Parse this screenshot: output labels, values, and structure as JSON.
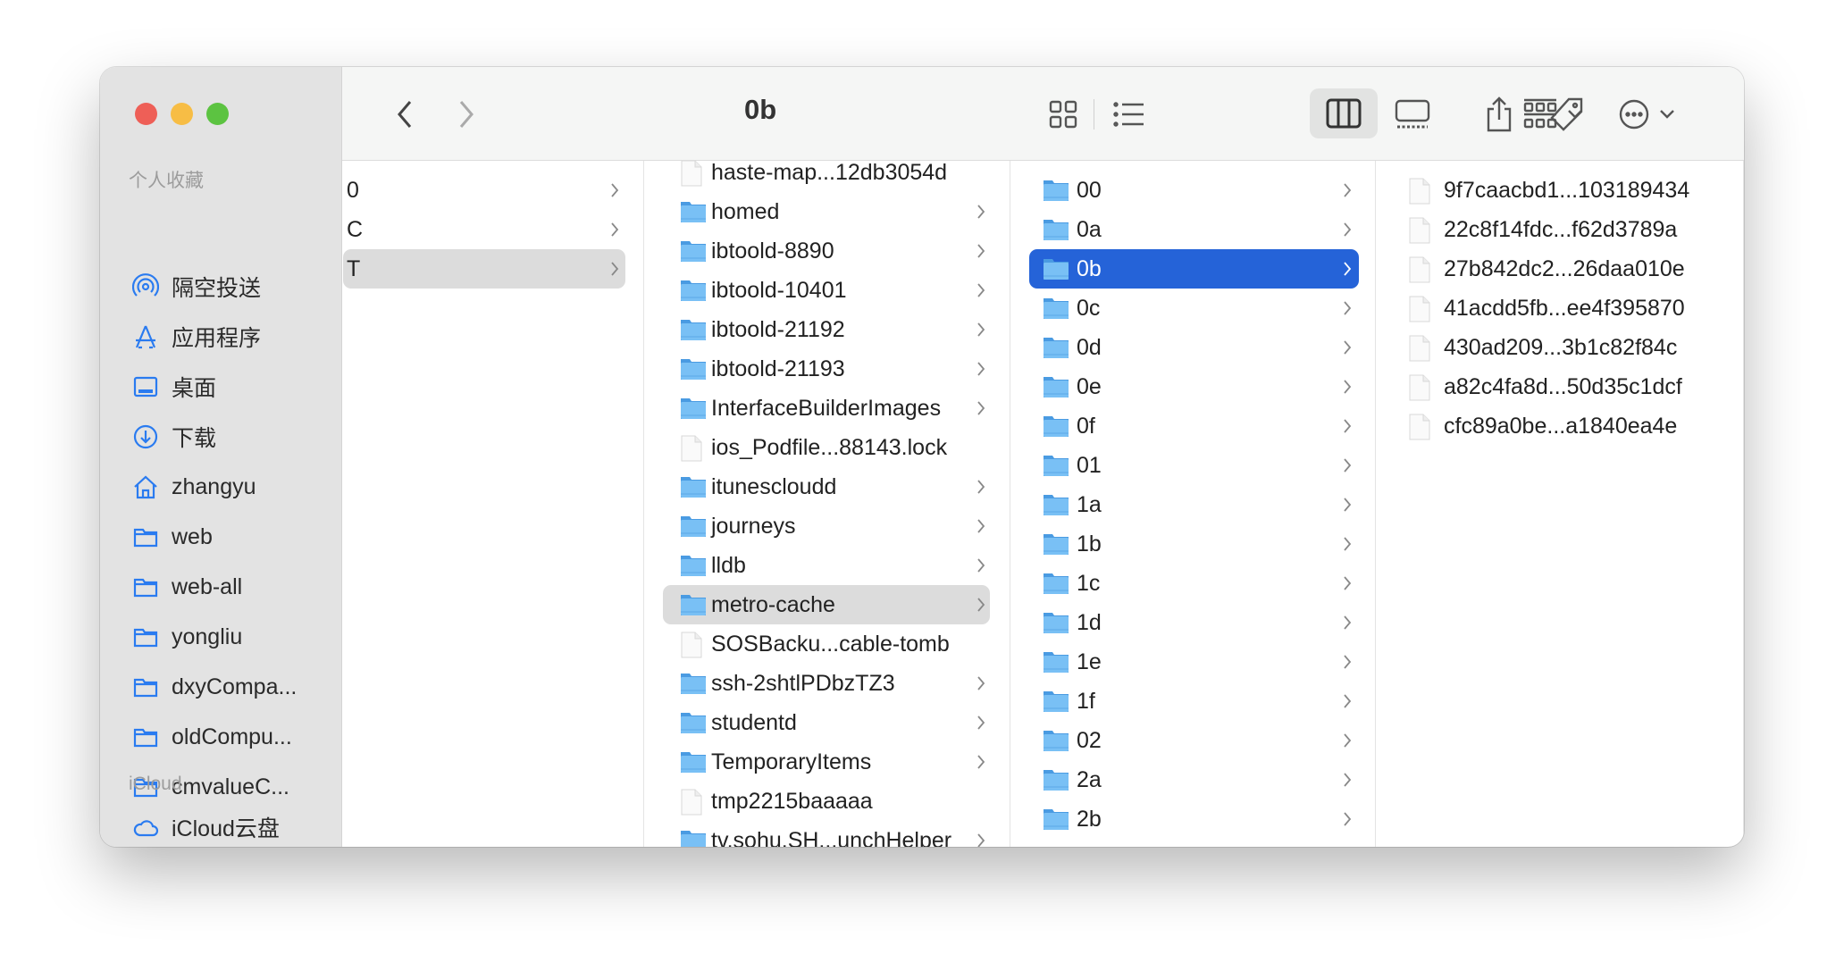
{
  "window": {
    "title": "0b"
  },
  "colors": {
    "accent": "#2563d8",
    "folder": "#6fb8f0",
    "sidebar_icon": "#2a7bf0",
    "close": "#ee5f57",
    "minimize": "#f7bd45",
    "zoom": "#5cc341"
  },
  "sidebar": {
    "favorites_header": "个人收藏",
    "favorites": [
      {
        "label": "隔空投送",
        "icon": "airdrop-icon"
      },
      {
        "label": "应用程序",
        "icon": "applications-icon"
      },
      {
        "label": "桌面",
        "icon": "desktop-icon"
      },
      {
        "label": "下载",
        "icon": "downloads-icon"
      },
      {
        "label": "zhangyu",
        "icon": "home-icon"
      },
      {
        "label": "web",
        "icon": "folder-icon"
      },
      {
        "label": "web-all",
        "icon": "folder-icon"
      },
      {
        "label": "yongliu",
        "icon": "folder-icon"
      },
      {
        "label": "dxyCompa...",
        "icon": "folder-icon"
      },
      {
        "label": "oldCompu...",
        "icon": "folder-icon"
      },
      {
        "label": "cmvalueC...",
        "icon": "folder-icon"
      }
    ],
    "icloud_header": "iCloud",
    "icloud": [
      {
        "label": "iCloud云盘",
        "icon": "cloud-icon"
      }
    ]
  },
  "toolbar": {
    "buttons": [
      "back-icon",
      "forward-icon",
      "icon-view-icon",
      "list-view-icon",
      "column-view-icon",
      "gallery-view-icon",
      "group-icon",
      "share-icon",
      "tag-icon",
      "more-icon",
      "search-icon"
    ],
    "active_view": "column-view"
  },
  "columns": [
    {
      "selected": "T",
      "items": [
        {
          "name": "0",
          "type": "folder-plain"
        },
        {
          "name": "C",
          "type": "folder-plain"
        },
        {
          "name": "T",
          "type": "folder-plain"
        }
      ]
    },
    {
      "selected": "metro-cache",
      "items": [
        {
          "name": "haste-map...12db3054d",
          "type": "file"
        },
        {
          "name": "homed",
          "type": "folder"
        },
        {
          "name": "ibtoold-8890",
          "type": "folder"
        },
        {
          "name": "ibtoold-10401",
          "type": "folder"
        },
        {
          "name": "ibtoold-21192",
          "type": "folder"
        },
        {
          "name": "ibtoold-21193",
          "type": "folder"
        },
        {
          "name": "InterfaceBuilderImages",
          "type": "folder"
        },
        {
          "name": "ios_Podfile...88143.lock",
          "type": "file"
        },
        {
          "name": "itunescloudd",
          "type": "folder"
        },
        {
          "name": "journeys",
          "type": "folder"
        },
        {
          "name": "lldb",
          "type": "folder"
        },
        {
          "name": "metro-cache",
          "type": "folder"
        },
        {
          "name": "SOSBacku...cable-tomb",
          "type": "file"
        },
        {
          "name": "ssh-2shtlPDbzTZ3",
          "type": "folder"
        },
        {
          "name": "studentd",
          "type": "folder"
        },
        {
          "name": "TemporaryItems",
          "type": "folder"
        },
        {
          "name": "tmp2215baaaaa",
          "type": "file"
        },
        {
          "name": "tv.sohu.SH...unchHelper",
          "type": "folder"
        }
      ]
    },
    {
      "selected": "0b",
      "items": [
        {
          "name": "00",
          "type": "folder"
        },
        {
          "name": "0a",
          "type": "folder"
        },
        {
          "name": "0b",
          "type": "folder"
        },
        {
          "name": "0c",
          "type": "folder"
        },
        {
          "name": "0d",
          "type": "folder"
        },
        {
          "name": "0e",
          "type": "folder"
        },
        {
          "name": "0f",
          "type": "folder"
        },
        {
          "name": "01",
          "type": "folder"
        },
        {
          "name": "1a",
          "type": "folder"
        },
        {
          "name": "1b",
          "type": "folder"
        },
        {
          "name": "1c",
          "type": "folder"
        },
        {
          "name": "1d",
          "type": "folder"
        },
        {
          "name": "1e",
          "type": "folder"
        },
        {
          "name": "1f",
          "type": "folder"
        },
        {
          "name": "02",
          "type": "folder"
        },
        {
          "name": "2a",
          "type": "folder"
        },
        {
          "name": "2b",
          "type": "folder"
        }
      ]
    },
    {
      "selected": null,
      "items": [
        {
          "name": "9f7caacbd1...103189434",
          "type": "file"
        },
        {
          "name": "22c8f14fdc...f62d3789a",
          "type": "file"
        },
        {
          "name": "27b842dc2...26daa010e",
          "type": "file"
        },
        {
          "name": "41acdd5fb...ee4f395870",
          "type": "file"
        },
        {
          "name": "430ad209...3b1c82f84c",
          "type": "file"
        },
        {
          "name": "a82c4fa8d...50d35c1dcf",
          "type": "file"
        },
        {
          "name": "cfc89a0be...a1840ea4e",
          "type": "file"
        }
      ]
    }
  ]
}
